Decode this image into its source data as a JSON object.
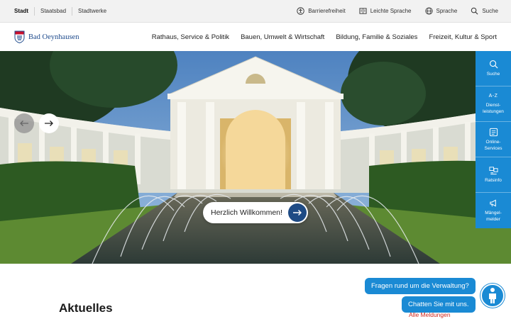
{
  "topbar": {
    "portals": [
      "Stadt",
      "Staatsbad",
      "Stadtwerke"
    ],
    "tools": [
      {
        "label": "Barrierefreiheit",
        "icon": "accessibility-icon"
      },
      {
        "label": "Leichte Sprache",
        "icon": "easy-language-icon"
      },
      {
        "label": "Sprache",
        "icon": "globe-icon"
      },
      {
        "label": "Suche",
        "icon": "search-icon"
      }
    ]
  },
  "header": {
    "logo_text": "Bad Oeynhausen",
    "nav": [
      "Rathaus, Service & Politik",
      "Bauen, Umwelt & Wirtschaft",
      "Bildung, Familie & Soziales",
      "Freizeit, Kultur & Sport"
    ]
  },
  "hero": {
    "welcome_label": "Herzlich Willkommen!"
  },
  "rail": [
    {
      "label": "Suche",
      "icon": "search-icon"
    },
    {
      "prefix": "A-Z",
      "label": "Dienst-leistungen",
      "icon": "a-z-icon"
    },
    {
      "label": "Online-Services",
      "icon": "online-services-icon"
    },
    {
      "label": "Ratsinfo",
      "icon": "council-icon"
    },
    {
      "label": "Mängel-melder",
      "icon": "megaphone-icon"
    }
  ],
  "content": {
    "section_title": "Aktuelles",
    "all_news_link": "Alle Meldungen"
  },
  "chat": {
    "question": "Fragen rund um die Verwaltung?",
    "answer": "Chatten Sie mit uns."
  },
  "colors": {
    "brand_blue": "#1a8ad4",
    "dark_blue": "#1e4b85",
    "link_red": "#d0281e"
  }
}
